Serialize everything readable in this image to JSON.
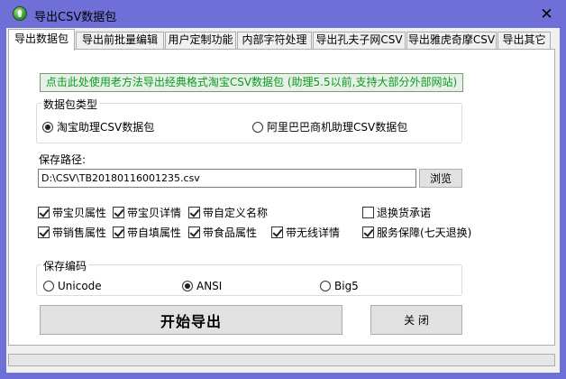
{
  "window": {
    "title": "导出CSV数据包",
    "close_glyph": "✕",
    "frame_color": "#6f6fd8"
  },
  "tabs": [
    {
      "label": "导出数据包",
      "active": true
    },
    {
      "label": "导出前批量编辑",
      "active": false
    },
    {
      "label": "用户定制功能",
      "active": false
    },
    {
      "label": "内部字符处理",
      "active": false
    },
    {
      "label": "导出孔夫子网CSV",
      "active": false
    },
    {
      "label": "导出雅虎奇摩CSV",
      "active": false
    },
    {
      "label": "导出其它",
      "active": false
    }
  ],
  "banner": {
    "text": "点击此处使用老方法导出经典格式淘宝CSV数据包 (助理5.5以前,支持大部分外部网站)",
    "color": "#0a9a1e"
  },
  "package_type": {
    "legend": "数据包类型",
    "options": [
      {
        "label": "淘宝助理CSV数据包",
        "selected": true
      },
      {
        "label": "阿里巴巴商机助理CSV数据包",
        "selected": false
      }
    ]
  },
  "save_path": {
    "label": "保存路径:",
    "value": "D:\\CSV\\TB20180116001235.csv",
    "browse_label": "浏览"
  },
  "options": [
    {
      "label": "带宝贝属性",
      "checked": true
    },
    {
      "label": "带宝贝详情",
      "checked": true
    },
    {
      "label": "带自定义名称",
      "checked": true
    },
    {
      "label": "退换货承诺",
      "checked": false
    },
    {
      "label": "带销售属性",
      "checked": true
    },
    {
      "label": "带自填属性",
      "checked": true
    },
    {
      "label": "带食品属性",
      "checked": true
    },
    {
      "label": "带无线详情",
      "checked": true
    },
    {
      "label": "服务保障(七天退换)",
      "checked": true
    }
  ],
  "encoding": {
    "legend": "保存编码",
    "options": [
      {
        "label": "Unicode",
        "selected": false
      },
      {
        "label": "ANSI",
        "selected": true
      },
      {
        "label": "Big5",
        "selected": false
      }
    ]
  },
  "actions": {
    "start_label": "开始导出",
    "close_label": "关 闭"
  }
}
